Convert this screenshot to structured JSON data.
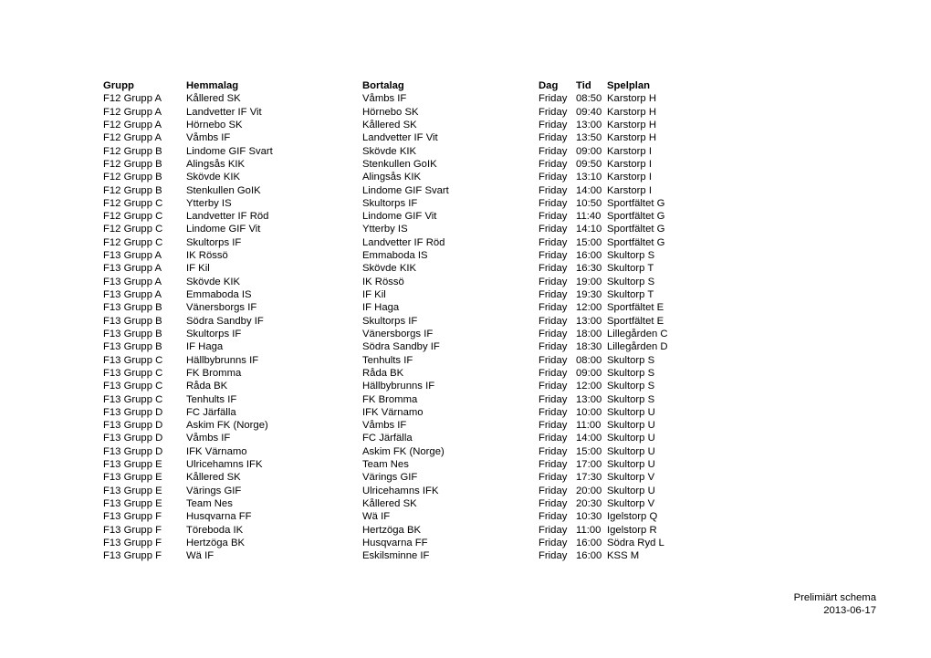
{
  "document": {
    "title": "Prelimiärt schema"
  },
  "table": {
    "headers": {
      "grupp": "Grupp",
      "hemmalag": "Hemmalag",
      "bortalag": "Bortalag",
      "dag": "Dag",
      "tid": "Tid",
      "spelplan": "Spelplan"
    },
    "rows": [
      {
        "grupp": "F12 Grupp A",
        "hemmalag": "Kållered SK",
        "bortalag": "Våmbs IF",
        "dag": "Friday",
        "tid": "08:50",
        "spelplan": "Karstorp H"
      },
      {
        "grupp": "F12 Grupp A",
        "hemmalag": "Landvetter IF Vit",
        "bortalag": "Hörnebo SK",
        "dag": "Friday",
        "tid": "09:40",
        "spelplan": "Karstorp H"
      },
      {
        "grupp": "F12 Grupp A",
        "hemmalag": "Hörnebo SK",
        "bortalag": "Kållered SK",
        "dag": "Friday",
        "tid": "13:00",
        "spelplan": "Karstorp H"
      },
      {
        "grupp": "F12 Grupp A",
        "hemmalag": "Våmbs IF",
        "bortalag": "Landvetter IF Vit",
        "dag": "Friday",
        "tid": "13:50",
        "spelplan": "Karstorp H"
      },
      {
        "grupp": "F12 Grupp B",
        "hemmalag": "Lindome GIF Svart",
        "bortalag": "Skövde KIK",
        "dag": "Friday",
        "tid": "09:00",
        "spelplan": "Karstorp I"
      },
      {
        "grupp": "F12 Grupp B",
        "hemmalag": "Alingsås KIK",
        "bortalag": "Stenkullen GoIK",
        "dag": "Friday",
        "tid": "09:50",
        "spelplan": "Karstorp I"
      },
      {
        "grupp": "F12 Grupp B",
        "hemmalag": "Skövde KIK",
        "bortalag": "Alingsås KIK",
        "dag": "Friday",
        "tid": "13:10",
        "spelplan": "Karstorp I"
      },
      {
        "grupp": "F12 Grupp B",
        "hemmalag": "Stenkullen GoIK",
        "bortalag": "Lindome GIF Svart",
        "dag": "Friday",
        "tid": "14:00",
        "spelplan": "Karstorp I"
      },
      {
        "grupp": "F12 Grupp C",
        "hemmalag": "Ytterby IS",
        "bortalag": "Skultorps IF",
        "dag": "Friday",
        "tid": "10:50",
        "spelplan": "Sportfältet G"
      },
      {
        "grupp": "F12 Grupp C",
        "hemmalag": "Landvetter IF Röd",
        "bortalag": "Lindome GIF Vit",
        "dag": "Friday",
        "tid": "11:40",
        "spelplan": "Sportfältet G"
      },
      {
        "grupp": "F12 Grupp C",
        "hemmalag": "Lindome GIF Vit",
        "bortalag": "Ytterby IS",
        "dag": "Friday",
        "tid": "14:10",
        "spelplan": "Sportfältet G"
      },
      {
        "grupp": "F12 Grupp C",
        "hemmalag": "Skultorps IF",
        "bortalag": "Landvetter IF Röd",
        "dag": "Friday",
        "tid": "15:00",
        "spelplan": "Sportfältet G"
      },
      {
        "grupp": "F13 Grupp A",
        "hemmalag": "IK Rössö",
        "bortalag": "Emmaboda IS",
        "dag": "Friday",
        "tid": "16:00",
        "spelplan": "Skultorp S"
      },
      {
        "grupp": "F13 Grupp A",
        "hemmalag": "IF Kil",
        "bortalag": "Skövde KIK",
        "dag": "Friday",
        "tid": "16:30",
        "spelplan": "Skultorp T"
      },
      {
        "grupp": "F13 Grupp A",
        "hemmalag": "Skövde KIK",
        "bortalag": "IK Rössö",
        "dag": "Friday",
        "tid": "19:00",
        "spelplan": "Skultorp S"
      },
      {
        "grupp": "F13 Grupp A",
        "hemmalag": "Emmaboda IS",
        "bortalag": "IF Kil",
        "dag": "Friday",
        "tid": "19:30",
        "spelplan": "Skultorp T"
      },
      {
        "grupp": "F13 Grupp B",
        "hemmalag": "Vänersborgs IF",
        "bortalag": "IF Haga",
        "dag": "Friday",
        "tid": "12:00",
        "spelplan": "Sportfältet E"
      },
      {
        "grupp": "F13 Grupp B",
        "hemmalag": "Södra Sandby IF",
        "bortalag": "Skultorps IF",
        "dag": "Friday",
        "tid": "13:00",
        "spelplan": "Sportfältet E"
      },
      {
        "grupp": "F13 Grupp B",
        "hemmalag": "Skultorps IF",
        "bortalag": "Vänersborgs IF",
        "dag": "Friday",
        "tid": "18:00",
        "spelplan": "Lillegården C"
      },
      {
        "grupp": "F13 Grupp B",
        "hemmalag": "IF Haga",
        "bortalag": "Södra Sandby IF",
        "dag": "Friday",
        "tid": "18:30",
        "spelplan": "Lillegården D"
      },
      {
        "grupp": "F13 Grupp C",
        "hemmalag": "Hällbybrunns IF",
        "bortalag": "Tenhults IF",
        "dag": "Friday",
        "tid": "08:00",
        "spelplan": "Skultorp S"
      },
      {
        "grupp": "F13 Grupp C",
        "hemmalag": "FK Bromma",
        "bortalag": "Råda BK",
        "dag": "Friday",
        "tid": "09:00",
        "spelplan": "Skultorp S"
      },
      {
        "grupp": "F13 Grupp C",
        "hemmalag": "Råda BK",
        "bortalag": "Hällbybrunns IF",
        "dag": "Friday",
        "tid": "12:00",
        "spelplan": "Skultorp S"
      },
      {
        "grupp": "F13 Grupp C",
        "hemmalag": "Tenhults IF",
        "bortalag": "FK Bromma",
        "dag": "Friday",
        "tid": "13:00",
        "spelplan": "Skultorp S"
      },
      {
        "grupp": "F13 Grupp D",
        "hemmalag": "FC Järfälla",
        "bortalag": "IFK Värnamo",
        "dag": "Friday",
        "tid": "10:00",
        "spelplan": "Skultorp U"
      },
      {
        "grupp": "F13 Grupp D",
        "hemmalag": "Askim FK (Norge)",
        "bortalag": "Våmbs IF",
        "dag": "Friday",
        "tid": "11:00",
        "spelplan": "Skultorp U"
      },
      {
        "grupp": "F13 Grupp D",
        "hemmalag": "Våmbs IF",
        "bortalag": "FC Järfälla",
        "dag": "Friday",
        "tid": "14:00",
        "spelplan": "Skultorp U"
      },
      {
        "grupp": "F13 Grupp D",
        "hemmalag": "IFK Värnamo",
        "bortalag": "Askim FK (Norge)",
        "dag": "Friday",
        "tid": "15:00",
        "spelplan": "Skultorp U"
      },
      {
        "grupp": "F13 Grupp E",
        "hemmalag": "Ulricehamns IFK",
        "bortalag": "Team Nes",
        "dag": "Friday",
        "tid": "17:00",
        "spelplan": "Skultorp U"
      },
      {
        "grupp": "F13 Grupp E",
        "hemmalag": "Kållered SK",
        "bortalag": "Värings GIF",
        "dag": "Friday",
        "tid": "17:30",
        "spelplan": "Skultorp V"
      },
      {
        "grupp": "F13 Grupp E",
        "hemmalag": "Värings GIF",
        "bortalag": "Ulricehamns IFK",
        "dag": "Friday",
        "tid": "20:00",
        "spelplan": "Skultorp U"
      },
      {
        "grupp": "F13 Grupp E",
        "hemmalag": "Team Nes",
        "bortalag": "Kållered SK",
        "dag": "Friday",
        "tid": "20:30",
        "spelplan": "Skultorp V"
      },
      {
        "grupp": "F13 Grupp F",
        "hemmalag": "Husqvarna FF",
        "bortalag": "Wä IF",
        "dag": "Friday",
        "tid": "10:30",
        "spelplan": "Igelstorp Q"
      },
      {
        "grupp": "F13 Grupp F",
        "hemmalag": "Töreboda IK",
        "bortalag": "Hertzöga BK",
        "dag": "Friday",
        "tid": "11:00",
        "spelplan": "Igelstorp R"
      },
      {
        "grupp": "F13 Grupp F",
        "hemmalag": "Hertzöga BK",
        "bortalag": "Husqvarna FF",
        "dag": "Friday",
        "tid": "16:00",
        "spelplan": "Södra Ryd L"
      },
      {
        "grupp": "F13 Grupp F",
        "hemmalag": "Wä IF",
        "bortalag": "Eskilsminne IF",
        "dag": "Friday",
        "tid": "16:00",
        "spelplan": "KSS M"
      }
    ]
  },
  "footer": {
    "line1": "Prelimiärt schema",
    "line2": "2013-06-17"
  }
}
